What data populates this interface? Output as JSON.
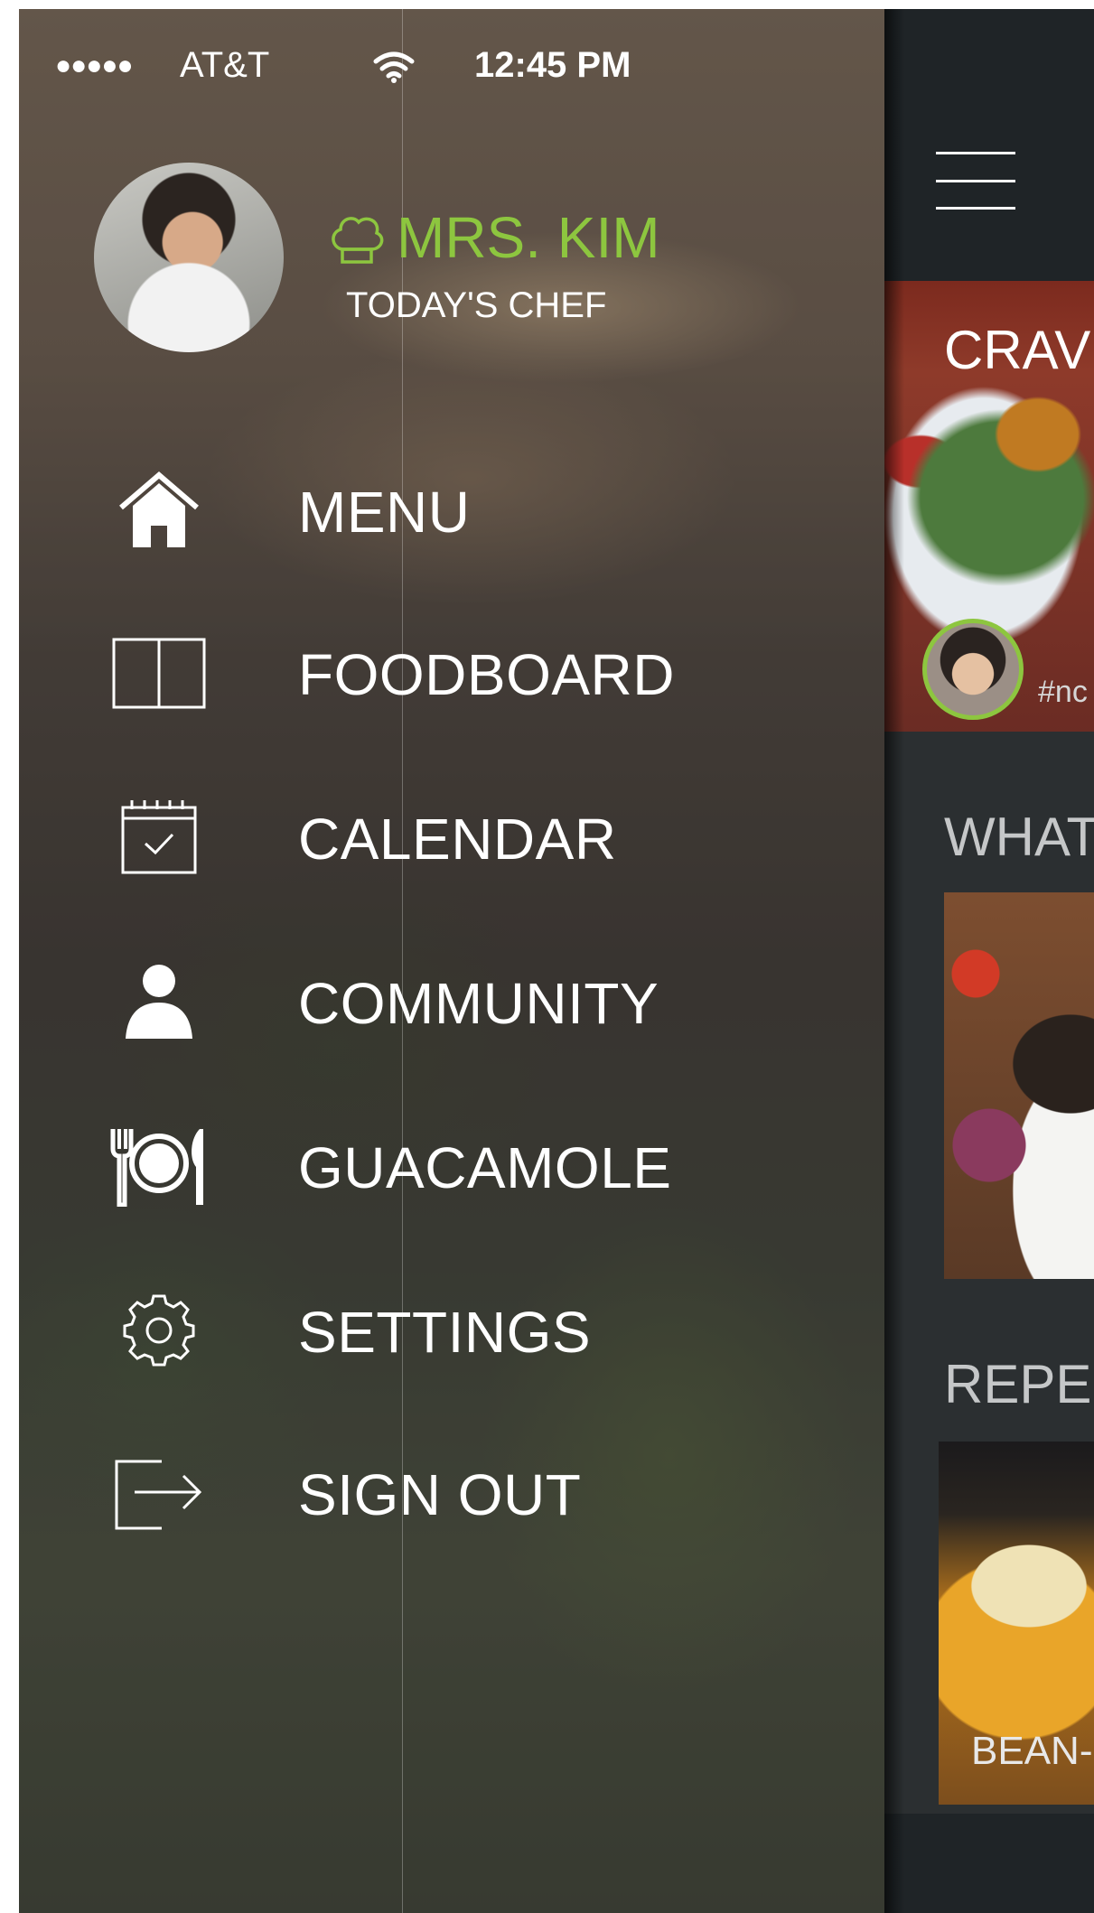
{
  "status_bar": {
    "signal": "●●●●●",
    "carrier": "AT&T",
    "wifi_icon": "wifi-icon",
    "time": "12:45 PM"
  },
  "profile": {
    "name": "MRS. KIM",
    "subtitle": "TODAY'S CHEF",
    "name_color": "#8dc63f",
    "badge_icon": "chef-hat-icon"
  },
  "menu": {
    "items": [
      {
        "label": "MENU",
        "icon": "home-icon"
      },
      {
        "label": "FOODBOARD",
        "icon": "open-book-icon"
      },
      {
        "label": "CALENDAR",
        "icon": "calendar-icon"
      },
      {
        "label": "COMMUNITY",
        "icon": "person-icon"
      },
      {
        "label": "GUACAMOLE",
        "icon": "plate-cutlery-icon"
      },
      {
        "label": "SETTINGS",
        "icon": "gear-icon"
      },
      {
        "label": "SIGN OUT",
        "icon": "sign-out-icon"
      }
    ]
  },
  "main": {
    "menu_icon": "hamburger-icon",
    "card1_title": "CRAVI",
    "card1_tag": "#nc",
    "section2_title": "WHAT'",
    "section3_title": "REPER",
    "card3_label": "BEAN-F"
  }
}
